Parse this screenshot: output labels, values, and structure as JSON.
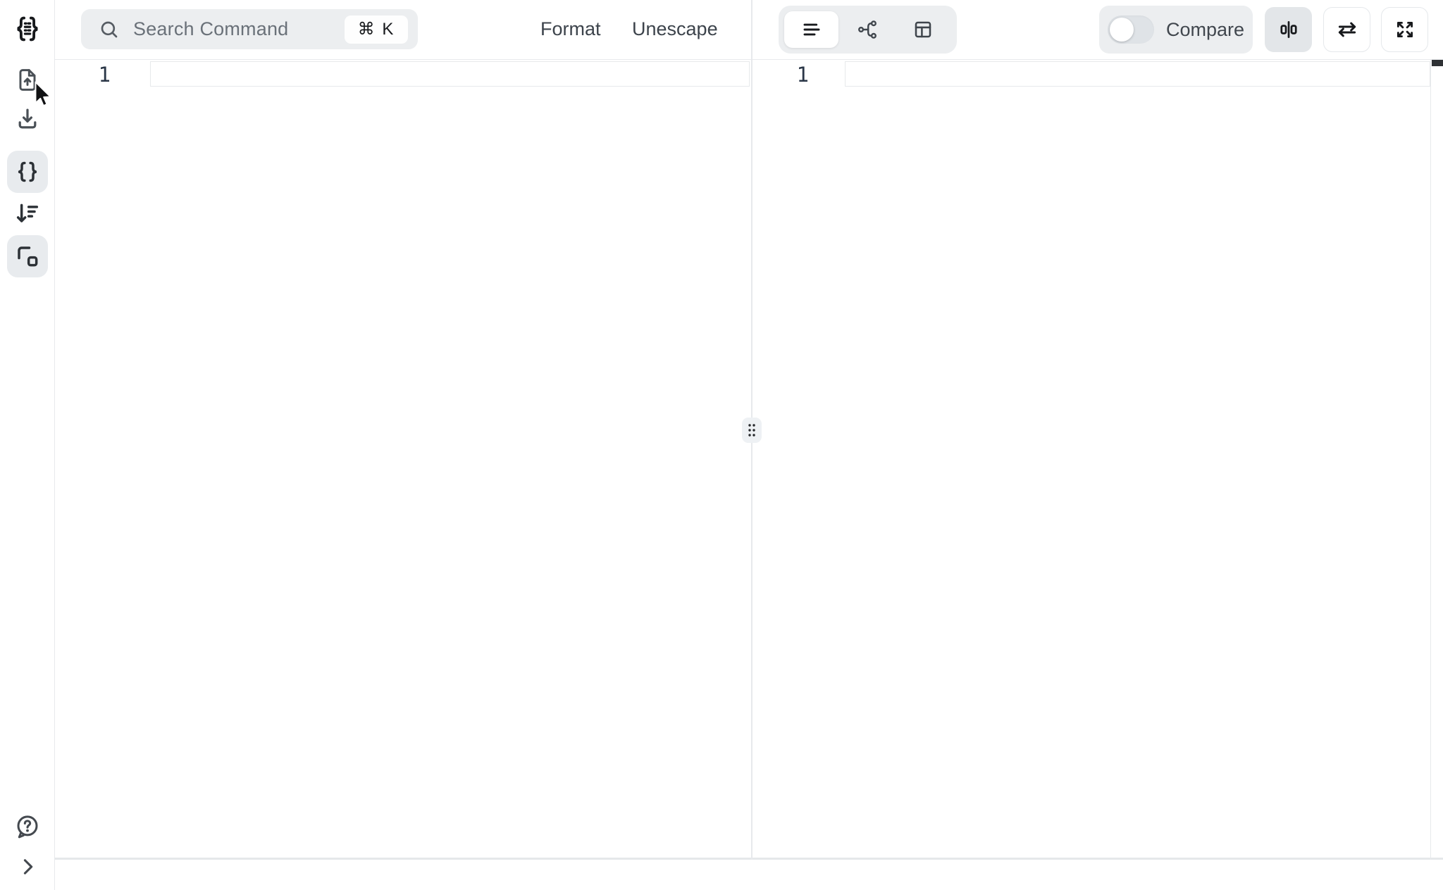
{
  "app": {
    "name": "JSON editor workspace"
  },
  "colors": {
    "surface": "#ffffff",
    "border": "#e7e9ec",
    "muted_bg": "#eceef0",
    "active_item_bg": "#e8ebee",
    "icon": "#3c4248",
    "icon_strong": "#17191c",
    "text_primary": "#3c434b",
    "text_muted": "#6a7179",
    "line_number": "#2a3647",
    "scrollbar_thumb": "#2e3134"
  },
  "sidebar": {
    "logo_icon": "json-braces-logo",
    "items": [
      {
        "name": "upload-file",
        "icon": "file-upload-icon",
        "active": false
      },
      {
        "name": "download",
        "icon": "download-icon",
        "active": false
      },
      {
        "name": "format-braces",
        "icon": "curly-braces-icon",
        "active": true
      },
      {
        "name": "sort",
        "icon": "sort-descending-icon",
        "active": false
      },
      {
        "name": "transform",
        "icon": "transform-icon",
        "active": true
      },
      {
        "name": "help",
        "icon": "help-bubble-icon",
        "active": false
      },
      {
        "name": "collapse-sidebar",
        "icon": "chevron-right-icon",
        "active": false
      }
    ]
  },
  "toolbar": {
    "search": {
      "placeholder": "Search Command",
      "shortcut": "⌘ K"
    },
    "actions": {
      "format": "Format",
      "unescape": "Unescape"
    },
    "view_switcher": {
      "options": [
        "text",
        "graph",
        "table"
      ],
      "active": "text"
    },
    "compare": {
      "label": "Compare",
      "enabled": false
    },
    "right_buttons": [
      "split-compare",
      "swap",
      "fullscreen"
    ]
  },
  "panes": {
    "left": {
      "line_number": "1",
      "content": ""
    },
    "right": {
      "line_number": "1",
      "content": ""
    }
  }
}
